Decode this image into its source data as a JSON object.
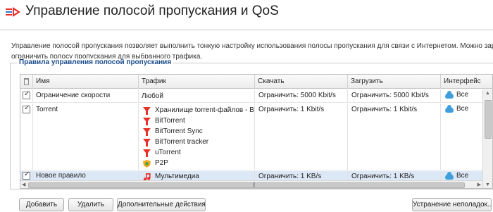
{
  "page": {
    "title": "Управление полосой пропускания и QoS",
    "description_line1": "Управление полосой пропускания позволяет выполнить тонкую настройку использования полосы пропускания для связи с Интернетом. Можно зарезервировать или",
    "description_line2": "ограничить полосу пропускания для выбранного трафика."
  },
  "group": {
    "legend": "Правила управления полосой пропускания"
  },
  "table": {
    "columns": [
      "Имя",
      "Трафик",
      "Скачать",
      "Загрузить",
      "Интерфейс"
    ],
    "rows": [
      {
        "checked": true,
        "name": "Ограничение скорости",
        "traffic": [
          {
            "icon": "none",
            "label": "Любой"
          }
        ],
        "download": "Ограничить: 5000 Kbit/s",
        "upload": "Ограничить: 5000 Kbit/s",
        "interface": "Все"
      },
      {
        "checked": true,
        "name": "Torrent",
        "traffic": [
          {
            "icon": "funnel-icon",
            "label": "Хранилище torrent-файлов - B..."
          },
          {
            "icon": "funnel-icon",
            "label": "BitTorrent"
          },
          {
            "icon": "funnel-icon",
            "label": "BitTorrent Sync"
          },
          {
            "icon": "funnel-icon",
            "label": "BitTorrent tracker"
          },
          {
            "icon": "funnel-icon",
            "label": "uTorrent"
          },
          {
            "icon": "p2p-shield-icon",
            "label": "P2P"
          }
        ],
        "download": "Ограничить: 1 Kbit/s",
        "upload": "Ограничить: 1 Kbit/s",
        "interface": "Все"
      },
      {
        "checked": true,
        "name": "Новое правило",
        "traffic": [
          {
            "icon": "music-note-icon",
            "label": "Мультимедиа"
          }
        ],
        "download": "Ограничить: 1 KB/s",
        "upload": "Ограничить: 1 KB/s",
        "interface": "Все"
      }
    ]
  },
  "buttons": {
    "add": "Добавить",
    "delete": "Удалить",
    "more_actions": "Дополнительные действия",
    "troubleshoot": "Устранение неполадок..."
  },
  "colors": {
    "accent": "#1b4c8c",
    "funnel": "#e8312a",
    "cloud": "#3f9fdc",
    "selected_row": "#dde8f6"
  }
}
